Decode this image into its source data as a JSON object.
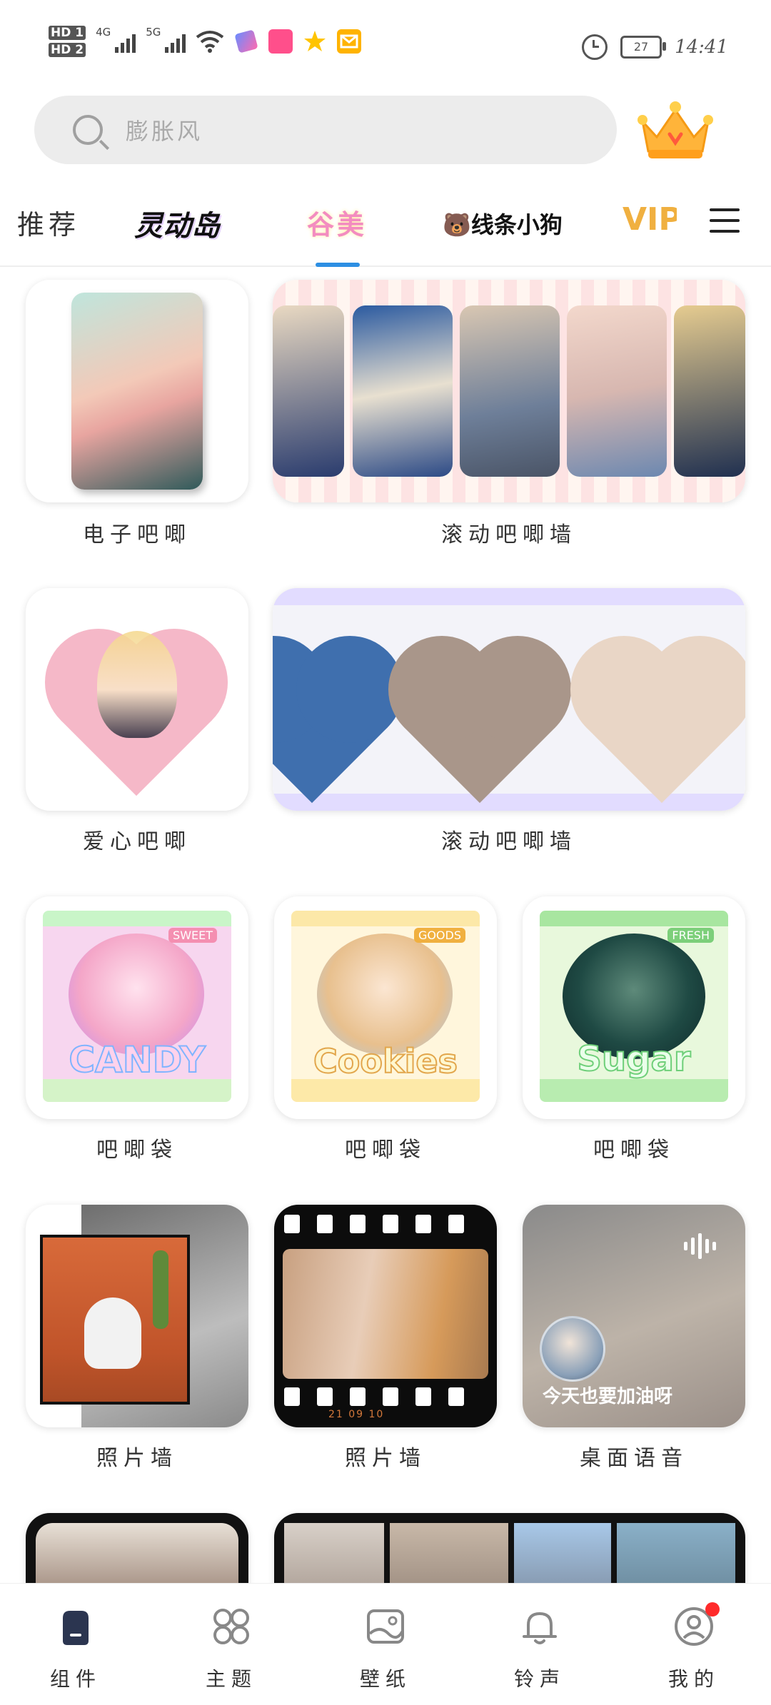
{
  "status_bar": {
    "hd1": "HD 1",
    "hd2": "HD 2",
    "net1": "4G",
    "net2": "5G",
    "battery": "27",
    "time": "14:41"
  },
  "search": {
    "placeholder": "膨胀风"
  },
  "tabs": {
    "recommend": "推荐",
    "lingdongdao": "灵动岛",
    "gumei": "谷美",
    "xiantiao": "🐻线条小狗",
    "vip": "VIP",
    "active": "谷美"
  },
  "grid": {
    "row1": {
      "left_label": "电子吧唧",
      "right_label": "滚动吧唧墙"
    },
    "row2": {
      "left_label": "爱心吧唧",
      "right_label": "滚动吧唧墙"
    },
    "row3": {
      "bags": [
        {
          "label": "吧唧袋",
          "word": "CANDY",
          "tag": "SWEET"
        },
        {
          "label": "吧唧袋",
          "word": "Cookies",
          "tag": "GOODS"
        },
        {
          "label": "吧唧袋",
          "word": "Sugar",
          "tag": "FRESH"
        }
      ]
    },
    "row4": {
      "left_label": "照片墙",
      "mid_label": "照片墙",
      "right_label": "桌面语音",
      "film_date": "21 09 10",
      "voice_text": "今天也要加油呀"
    }
  },
  "nav": {
    "items": [
      {
        "label": "组件",
        "icon": "widget-icon",
        "active": true
      },
      {
        "label": "主题",
        "icon": "theme-icon"
      },
      {
        "label": "壁纸",
        "icon": "wallpaper-icon"
      },
      {
        "label": "铃声",
        "icon": "bell-icon"
      },
      {
        "label": "我的",
        "icon": "profile-icon",
        "badge": true
      }
    ]
  },
  "colors": {
    "accent": "#2d8fe3",
    "badge": "#ff2a2a",
    "nav_active": "#2b3550"
  }
}
